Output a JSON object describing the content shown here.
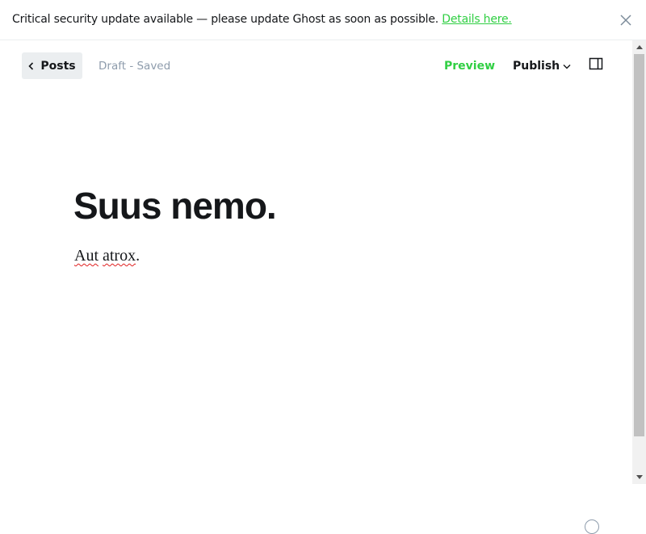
{
  "banner": {
    "message": "Critical security update available — please update Ghost as soon as possible.",
    "link_text": "Details here.",
    "close_icon": "close-icon"
  },
  "toolbar": {
    "back_label": "Posts",
    "back_icon": "chevron-left-icon",
    "status": "Draft - Saved",
    "preview_label": "Preview",
    "publish_label": "Publish",
    "publish_icon": "chevron-down-icon",
    "sidebar_icon": "sidebar-toggle-icon"
  },
  "post": {
    "title": "Suus nemo.",
    "body_words": [
      "Aut",
      "atrox"
    ],
    "body_punct": "."
  },
  "colors": {
    "accent_green": "#30cf43",
    "text_dark": "#15171a",
    "text_muted": "#8e9cac",
    "button_bg": "#ebeef0",
    "spellcheck_red": "#e02020"
  }
}
